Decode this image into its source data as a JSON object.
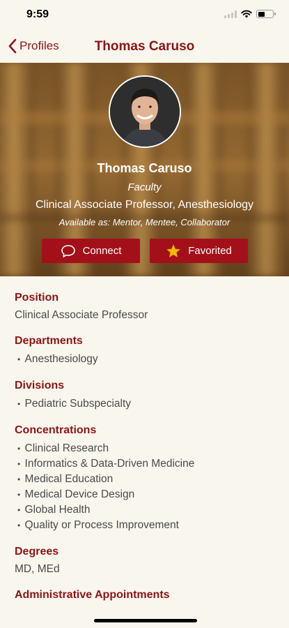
{
  "status_bar": {
    "time": "9:59"
  },
  "nav": {
    "back_label": "Profiles",
    "title": "Thomas Caruso"
  },
  "profile": {
    "name": "Thomas Caruso",
    "role": "Faculty",
    "title": "Clinical Associate Professor, Anesthesiology",
    "availability": "Available as: Mentor, Mentee, Collaborator"
  },
  "actions": {
    "connect_label": "Connect",
    "favorite_label": "Favorited"
  },
  "sections": {
    "position": {
      "heading": "Position",
      "value": "Clinical Associate Professor"
    },
    "departments": {
      "heading": "Departments",
      "items": [
        "Anesthesiology"
      ]
    },
    "divisions": {
      "heading": "Divisions",
      "items": [
        "Pediatric Subspecialty"
      ]
    },
    "concentrations": {
      "heading": "Concentrations",
      "items": [
        "Clinical Research",
        "Informatics & Data-Driven Medicine",
        "Medical Education",
        "Medical Device Design",
        "Global Health",
        "Quality or Process Improvement"
      ]
    },
    "degrees": {
      "heading": "Degrees",
      "value": "MD, MEd"
    },
    "administrative": {
      "heading": "Administrative Appointments"
    }
  },
  "colors": {
    "accent": "#8c1515",
    "button": "#a3101a",
    "background": "#f9f6ee",
    "star": "#f5b700"
  },
  "icons": [
    "chevron-left-icon",
    "signal-icon",
    "wifi-icon",
    "battery-icon",
    "chat-bubble-icon",
    "star-icon"
  ]
}
